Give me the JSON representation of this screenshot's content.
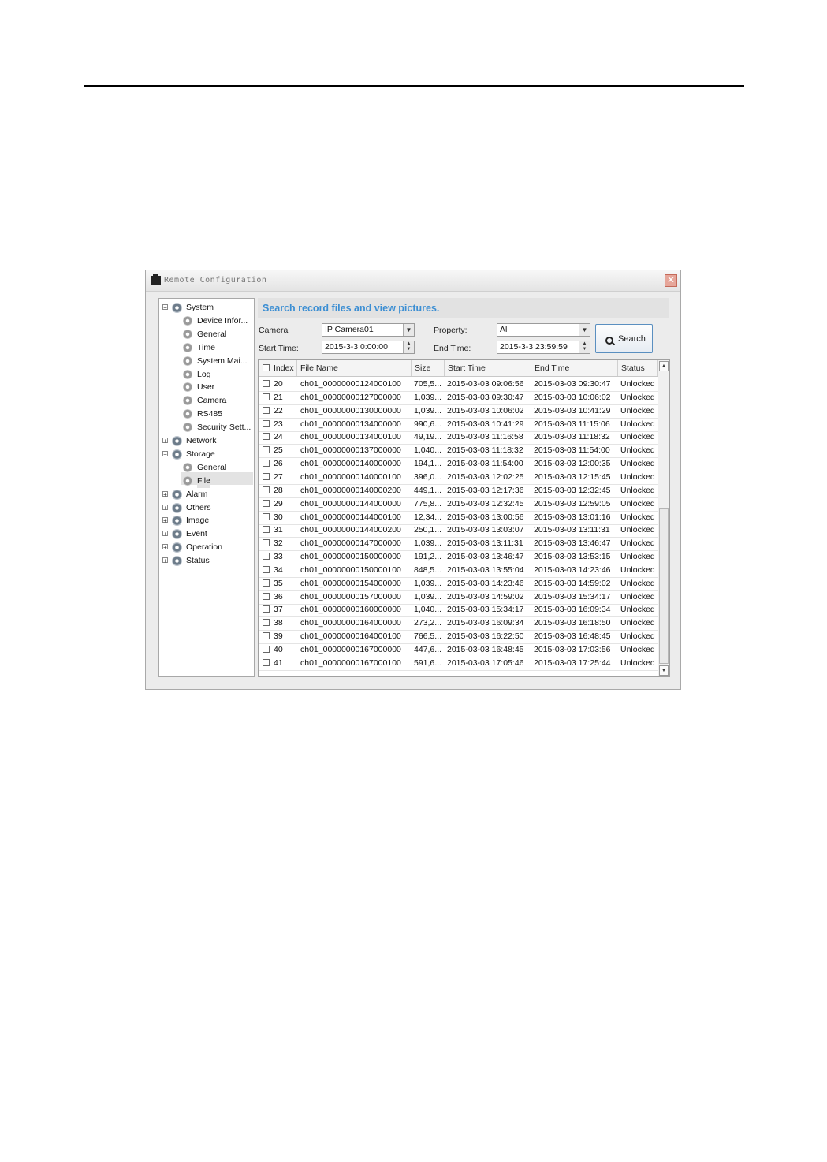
{
  "window": {
    "title": "Remote Configuration",
    "close_glyph": "✕"
  },
  "tree": [
    {
      "label": "System",
      "expander": "−"
    },
    {
      "label": "Device Infor..."
    },
    {
      "label": "General"
    },
    {
      "label": "Time"
    },
    {
      "label": "System Mai..."
    },
    {
      "label": "Log"
    },
    {
      "label": "User"
    },
    {
      "label": "Camera"
    },
    {
      "label": "RS485"
    },
    {
      "label": "Security Sett..."
    },
    {
      "label": "Network",
      "expander": "+"
    },
    {
      "label": "Storage",
      "expander": "−"
    },
    {
      "label": "General"
    },
    {
      "label": "File"
    },
    {
      "label": "Alarm",
      "expander": "+"
    },
    {
      "label": "Others",
      "expander": "+"
    },
    {
      "label": "Image",
      "expander": "+"
    },
    {
      "label": "Event",
      "expander": "+"
    },
    {
      "label": "Operation",
      "expander": "+"
    },
    {
      "label": "Status",
      "expander": "+"
    }
  ],
  "panel": {
    "banner": "Search record files and view pictures.",
    "camera_label": "Camera",
    "camera_value": "IP Camera01",
    "property_label": "Property:",
    "property_value": "All",
    "start_label": "Start Time:",
    "start_value": "2015-3-3 0:00:00",
    "end_label": "End Time:",
    "end_value": "2015-3-3 23:59:59",
    "search_button": "Search"
  },
  "table": {
    "headers": [
      "Index",
      "File Name",
      "Size",
      "Start Time",
      "End Time",
      "Status"
    ],
    "rows": [
      [
        "20",
        "ch01_00000000124000100",
        "705,5...",
        "2015-03-03 09:06:56",
        "2015-03-03 09:30:47",
        "Unlocked"
      ],
      [
        "21",
        "ch01_00000000127000000",
        "1,039...",
        "2015-03-03 09:30:47",
        "2015-03-03 10:06:02",
        "Unlocked"
      ],
      [
        "22",
        "ch01_00000000130000000",
        "1,039...",
        "2015-03-03 10:06:02",
        "2015-03-03 10:41:29",
        "Unlocked"
      ],
      [
        "23",
        "ch01_00000000134000000",
        "990,6...",
        "2015-03-03 10:41:29",
        "2015-03-03 11:15:06",
        "Unlocked"
      ],
      [
        "24",
        "ch01_00000000134000100",
        "49,19...",
        "2015-03-03 11:16:58",
        "2015-03-03 11:18:32",
        "Unlocked"
      ],
      [
        "25",
        "ch01_00000000137000000",
        "1,040...",
        "2015-03-03 11:18:32",
        "2015-03-03 11:54:00",
        "Unlocked"
      ],
      [
        "26",
        "ch01_00000000140000000",
        "194,1...",
        "2015-03-03 11:54:00",
        "2015-03-03 12:00:35",
        "Unlocked"
      ],
      [
        "27",
        "ch01_00000000140000100",
        "396,0...",
        "2015-03-03 12:02:25",
        "2015-03-03 12:15:45",
        "Unlocked"
      ],
      [
        "28",
        "ch01_00000000140000200",
        "449,1...",
        "2015-03-03 12:17:36",
        "2015-03-03 12:32:45",
        "Unlocked"
      ],
      [
        "29",
        "ch01_00000000144000000",
        "775,8...",
        "2015-03-03 12:32:45",
        "2015-03-03 12:59:05",
        "Unlocked"
      ],
      [
        "30",
        "ch01_00000000144000100",
        "12,34...",
        "2015-03-03 13:00:56",
        "2015-03-03 13:01:16",
        "Unlocked"
      ],
      [
        "31",
        "ch01_00000000144000200",
        "250,1...",
        "2015-03-03 13:03:07",
        "2015-03-03 13:11:31",
        "Unlocked"
      ],
      [
        "32",
        "ch01_00000000147000000",
        "1,039...",
        "2015-03-03 13:11:31",
        "2015-03-03 13:46:47",
        "Unlocked"
      ],
      [
        "33",
        "ch01_00000000150000000",
        "191,2...",
        "2015-03-03 13:46:47",
        "2015-03-03 13:53:15",
        "Unlocked"
      ],
      [
        "34",
        "ch01_00000000150000100",
        "848,5...",
        "2015-03-03 13:55:04",
        "2015-03-03 14:23:46",
        "Unlocked"
      ],
      [
        "35",
        "ch01_00000000154000000",
        "1,039...",
        "2015-03-03 14:23:46",
        "2015-03-03 14:59:02",
        "Unlocked"
      ],
      [
        "36",
        "ch01_00000000157000000",
        "1,039...",
        "2015-03-03 14:59:02",
        "2015-03-03 15:34:17",
        "Unlocked"
      ],
      [
        "37",
        "ch01_00000000160000000",
        "1,040...",
        "2015-03-03 15:34:17",
        "2015-03-03 16:09:34",
        "Unlocked"
      ],
      [
        "38",
        "ch01_00000000164000000",
        "273,2...",
        "2015-03-03 16:09:34",
        "2015-03-03 16:18:50",
        "Unlocked"
      ],
      [
        "39",
        "ch01_00000000164000100",
        "766,5...",
        "2015-03-03 16:22:50",
        "2015-03-03 16:48:45",
        "Unlocked"
      ],
      [
        "40",
        "ch01_00000000167000000",
        "447,6...",
        "2015-03-03 16:48:45",
        "2015-03-03 17:03:56",
        "Unlocked"
      ],
      [
        "41",
        "ch01_00000000167000100",
        "591,6...",
        "2015-03-03 17:05:46",
        "2015-03-03 17:25:44",
        "Unlocked"
      ]
    ]
  }
}
